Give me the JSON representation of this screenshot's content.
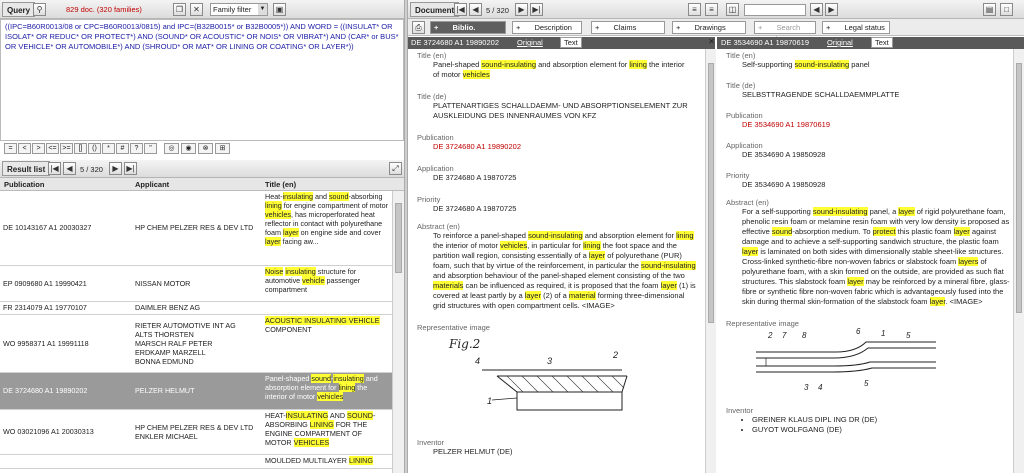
{
  "query": {
    "tab_label": "Query",
    "count_text": "829 doc. (320 families)",
    "filter_label": "Family filter",
    "text_parts": [
      {
        "t": "((IPC=B60R0013/08 or CPC=B60R0013/0815) and IPC=(B32B0015* or B32B0005*)) AND WORD = ((INSULAT* OR ",
        "c": "q"
      },
      {
        "t": "ISOLAT* OR REDUC* OR PROTECT*) AND (SOUND* OR ACOUSTIC* OR NOIS* OR VIBRAT*) AND (CAR* or BUS* ",
        "c": "q"
      },
      {
        "t": "OR VEHICLE* OR AUTOMOBILE*) AND (SHROUD* OR MAT* OR LINING OR COATING* OR LAYER*))",
        "c": "q"
      }
    ],
    "operators": [
      "=",
      "<",
      ">",
      "<=",
      ">=",
      "[]",
      "()",
      "*",
      "#",
      "?",
      "\""
    ]
  },
  "result_list": {
    "tab_label": "Result list",
    "position": "5 / 320",
    "columns": [
      "Publication",
      "Applicant",
      "Title (en)"
    ],
    "rows": [
      {
        "pub": "DE 10143167 A1 20030327",
        "app": [
          "HP CHEM PELZER RES & DEV LTD"
        ],
        "title": [
          [
            "Heat-",
            ""
          ],
          [
            "insulating",
            "h"
          ],
          [
            " and ",
            ""
          ],
          [
            "sound",
            "h"
          ],
          [
            "-absorbing ",
            ""
          ],
          [
            "lining",
            "h"
          ],
          [
            " for engine compartment of motor ",
            ""
          ],
          [
            "vehicles",
            "h"
          ],
          [
            ", has microperforated heat reflector in contact with polyurethane foam ",
            ""
          ],
          [
            "layer",
            "h"
          ],
          [
            " on engine side and cover ",
            ""
          ],
          [
            "layer",
            "h"
          ],
          [
            " facing aw...",
            ""
          ]
        ],
        "sel": false,
        "h": 74
      },
      {
        "pub": "EP 0909680 A1 19990421",
        "app": [
          "NISSAN MOTOR"
        ],
        "title": [
          [
            "Noise",
            "h"
          ],
          [
            " ",
            ""
          ],
          [
            "insulating",
            "h"
          ],
          [
            " structure for automotive ",
            ""
          ],
          [
            "vehicle",
            "h"
          ],
          [
            " passenger compartment",
            ""
          ]
        ],
        "sel": false,
        "h": 36
      },
      {
        "pub": "FR 2314079 A1 19770107",
        "app": [
          "DAIMLER BENZ AG"
        ],
        "title": [],
        "sel": false,
        "h": 13
      },
      {
        "pub": "WO 9958371 A1 19991118",
        "app": [
          "RIETER AUTOMOTIVE INT AG",
          "ALTS THORSTEN",
          "MARSCH RALF PETER",
          "ERDKAMP MARZELL",
          "BONNA EDMUND"
        ],
        "title": [
          [
            "ACOUSTIC INSULATING VEHICLE",
            "h"
          ],
          [
            " COMPONENT",
            ""
          ]
        ],
        "sel": false,
        "h": 58
      },
      {
        "pub": "DE 3724680 A1 19890202",
        "app": [
          "PELZER HELMUT"
        ],
        "title": [
          [
            "Panel-shaped ",
            ""
          ],
          [
            "sound",
            "h"
          ],
          [
            "-",
            ""
          ],
          [
            "insulating",
            "h"
          ],
          [
            " and absorption element for ",
            ""
          ],
          [
            "lining",
            "h"
          ],
          [
            " the interior of motor ",
            ""
          ],
          [
            "vehicles",
            "h"
          ]
        ],
        "sel": true,
        "h": 37
      },
      {
        "pub": "WO 03021096 A1 20030313",
        "app": [
          "HP CHEM PELZER RES & DEV LTD",
          "ENKLER MICHAEL"
        ],
        "title": [
          [
            "HEAT-",
            ""
          ],
          [
            "INSULATING",
            "h"
          ],
          [
            " AND ",
            ""
          ],
          [
            "SOUND",
            "h"
          ],
          [
            "-ABSORBING ",
            ""
          ],
          [
            "LINING",
            "h"
          ],
          [
            " FOR THE ENGINE COMPARTMENT OF MOTOR ",
            ""
          ],
          [
            "VEHICLES",
            "h"
          ]
        ],
        "sel": false,
        "h": 45
      },
      {
        "pub": "",
        "app": [],
        "title": [
          [
            "MOULDED MULTILAYER ",
            ""
          ],
          [
            "LINING",
            "h"
          ]
        ],
        "sel": false,
        "h": 14
      }
    ]
  },
  "document": {
    "tab_label": "Document",
    "position": "5 / 320",
    "tabs": [
      "Biblio.",
      "Description",
      "Claims",
      "Drawings",
      "Search report",
      "Legal status"
    ],
    "left": {
      "header_id": "DE 3724680 A1 19890202",
      "original": "Original",
      "text": "Text",
      "title_label": "Title (en)",
      "title": [
        [
          "Panel-shaped ",
          ""
        ],
        [
          "sound-insulating",
          "h"
        ],
        [
          " and absorption element for ",
          ""
        ],
        [
          "lining",
          "h"
        ],
        [
          " the interior of motor ",
          ""
        ],
        [
          "vehicles",
          "h"
        ]
      ],
      "title_de_label": "Title (de)",
      "title_de": "PLATTENARTIGES SCHALLDAEMM- UND ABSORPTIONSELEMENT ZUR AUSKLEIDUNG DES INNENRAUMES VON KFZ",
      "publication_label": "Publication",
      "publication": "DE 3724680 A1 19890202",
      "application_label": "Application",
      "application": "DE 3724680 A 19870725",
      "priority_label": "Priority",
      "priority": "DE 3724680 A 19870725",
      "abstract_label": "Abstract (en)",
      "abstract": [
        [
          "To reinforce a panel-shaped ",
          ""
        ],
        [
          "sound-insulating",
          "h"
        ],
        [
          " and absorption element for ",
          ""
        ],
        [
          "lining",
          "h"
        ],
        [
          " the interior of motor ",
          ""
        ],
        [
          "vehicles",
          "h"
        ],
        [
          ", in particular for ",
          ""
        ],
        [
          "lining",
          "h"
        ],
        [
          " the foot space and the partition wall region, consisting essentially of a ",
          ""
        ],
        [
          "layer",
          "h"
        ],
        [
          " of polyurethane (PUR) foam, such that by virtue of the reinforcement, in particular the ",
          ""
        ],
        [
          "sound-insulating",
          "h"
        ],
        [
          " and absorption behaviour of the panel-shaped element consisting of the two ",
          ""
        ],
        [
          "materials",
          "h"
        ],
        [
          " can be influenced as required, it is proposed that the foam ",
          ""
        ],
        [
          "layer",
          "h"
        ],
        [
          " (1) is covered at least partly by a ",
          ""
        ],
        [
          "layer",
          "h"
        ],
        [
          " (2) of a ",
          ""
        ],
        [
          "material",
          "h"
        ],
        [
          " forming three-dimensional grid structures with open compartment cells. <IMAGE>",
          ""
        ]
      ],
      "rep_image_label": "Representative image",
      "fig_label": "Fig.2",
      "inventor_label": "Inventor",
      "inventor": "PELZER HELMUT (DE)"
    },
    "right": {
      "header_id": "DE 3534690 A1 19870619",
      "original": "Original",
      "text": "Text",
      "title_label": "Title (en)",
      "title": [
        [
          "Self-supporting ",
          ""
        ],
        [
          "sound-insulating",
          "h"
        ],
        [
          " panel",
          ""
        ]
      ],
      "title_de_label": "Title (de)",
      "title_de": "SELBSTTRAGENDE SCHALLDAEMMPLATTE",
      "publication_label": "Publication",
      "publication": "DE 3534690 A1 19870619",
      "application_label": "Application",
      "application": "DE 3534690 A 19850928",
      "priority_label": "Priority",
      "priority": "DE 3534690 A 19850928",
      "abstract_label": "Abstract (en)",
      "abstract": [
        [
          "For a self-supporting ",
          ""
        ],
        [
          "sound-insulating",
          "h"
        ],
        [
          " panel, a ",
          ""
        ],
        [
          "layer",
          "h"
        ],
        [
          " of rigid polyurethane foam, phenolic resin foam or melamine resin foam with very low density is proposed as effective ",
          ""
        ],
        [
          "sound",
          "h"
        ],
        [
          "-absorption medium. To ",
          ""
        ],
        [
          "protect",
          "h"
        ],
        [
          " this plastic foam ",
          ""
        ],
        [
          "layer",
          "h"
        ],
        [
          " against damage and to achieve a self-supporting sandwich structure, the plastic foam ",
          ""
        ],
        [
          "layer",
          "h"
        ],
        [
          " is laminated on both sides with dimensionally stable sheet-like structures. Cross-linked synthetic-fibre non-woven fabrics or slabstock foam ",
          ""
        ],
        [
          "layers",
          "h"
        ],
        [
          " of polyurethane foam, with a skin formed on the outside, are provided as such flat structures. This slabstock foam ",
          ""
        ],
        [
          "layer",
          "h"
        ],
        [
          " may be reinforced by a mineral fibre, glass-fibre or synthetic fibre non-woven fabric which is advantageously fused into the skin during thermal skin-formation of the slabstock foam ",
          ""
        ],
        [
          "layer",
          "h"
        ],
        [
          ". <IMAGE>",
          ""
        ]
      ],
      "rep_image_label": "Representative image",
      "inventor_label": "Inventor",
      "inventors": [
        "GREINER KLAUS DIPL ING DR (DE)",
        "GUYOT WOLFGANG (DE)"
      ]
    }
  },
  "colors": {
    "highlight": "#ffff33",
    "red": "#c00000",
    "selected_row": "#9a9a9a",
    "header_dark": "#595959"
  }
}
